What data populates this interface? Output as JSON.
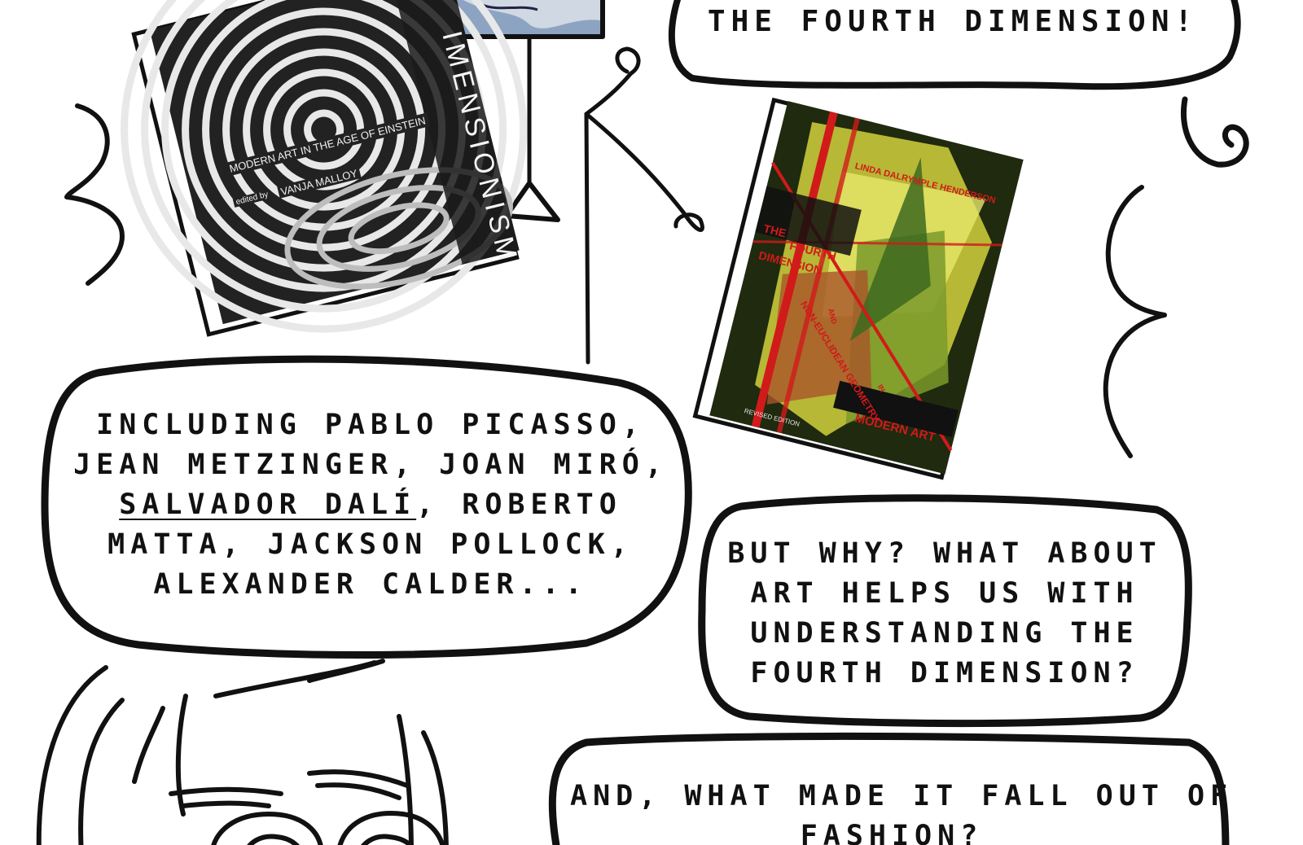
{
  "bubbles": {
    "top": {
      "text": "THE FOURTH DIMENSION!"
    },
    "artists": {
      "line1": "INCLUDING PABLO PICASSO,",
      "line2": "JEAN METZINGER, JOAN MIRÓ,",
      "line3_underlined": "SALVADOR DALÍ",
      "line3_rest": ", ROBERTO",
      "line4": "MATTA, JACKSON POLLOCK,",
      "line5": "ALEXANDER CALDER..."
    },
    "why": {
      "line1": "BUT WHY? WHAT ABOUT",
      "line2": "ART HELPS US WITH",
      "line3": "UNDERSTANDING THE",
      "line4": "FOURTH DIMENSION?"
    },
    "fashion": {
      "line1": "AND, WHAT MADE IT FALL OUT OF",
      "line2": "FASHION?"
    }
  },
  "book_left": {
    "spine_title": "IMENSIONISM",
    "subtitle": "MODERN ART IN THE AGE OF EINSTEIN",
    "editor_prefix": "edited by",
    "editor": "VANJA MALLOY"
  },
  "book_right": {
    "author": "LINDA DALRYMPLE HENDERSON",
    "title_the": "THE",
    "title_fourth": "FOURTH",
    "title_dimension": "DIMENSION",
    "title_and": "AND",
    "title_geometry": "NON-EUCLIDEAN GEOMETRY",
    "title_in": "IN",
    "title_modern_art": "MODERN ART",
    "edition": "REVISED EDITION"
  },
  "colors": {
    "ink": "#111111",
    "cover_red": "#d11a1a",
    "cover_yellow": "#c8c83a"
  }
}
